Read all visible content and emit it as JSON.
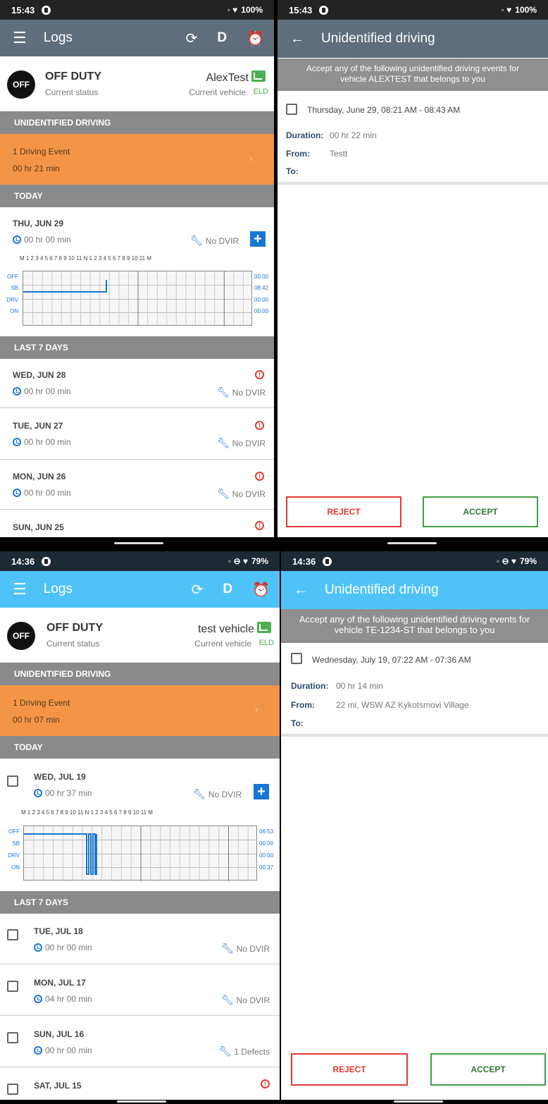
{
  "top_left": {
    "status_bar": {
      "time": "15:43",
      "battery": "100%"
    },
    "appbar": {
      "title": "Logs",
      "d_label": "D"
    },
    "status": {
      "badge": "OFF",
      "main": "OFF DUTY",
      "sub": "Current status",
      "vehicle": "AlexTest",
      "vehicle_sub": "Current vehicle",
      "eld": "ELD"
    },
    "unidentified_section": "UNIDENTIFIED DRIVING",
    "ud_event": {
      "title": "1 Driving Event",
      "duration": "00 hr  21 min"
    },
    "today_section": "TODAY",
    "today": {
      "date": "THU, JUN 29",
      "duration": "00 hr  00 min",
      "dvir": "No DVIR"
    },
    "grid": {
      "hours": "M 1 2 3 4 5 6 7 8 9 10 11 N 1 2 3 4 5 6 7 8 9 10 11 M",
      "rows": [
        "OFF",
        "SB",
        "DRV",
        "ON"
      ],
      "totals": [
        "00:00",
        "08:42",
        "00:00",
        "00:00"
      ]
    },
    "last7_section": "LAST 7 DAYS",
    "days": [
      {
        "date": "WED, JUN 28",
        "duration": "00 hr  00 min",
        "dvir": "No DVIR"
      },
      {
        "date": "TUE, JUN 27",
        "duration": "00 hr  00 min",
        "dvir": "No DVIR"
      },
      {
        "date": "MON, JUN 26",
        "duration": "00 hr  00 min",
        "dvir": "No DVIR"
      },
      {
        "date": "SUN, JUN 25"
      }
    ]
  },
  "top_right": {
    "status_bar": {
      "time": "15:43",
      "battery": "100%"
    },
    "header": {
      "title": "Unidentified driving"
    },
    "banner": {
      "line1": "Accept any of the following unidentified driving events for",
      "line2": "vehicle ALEXTEST that belongs to you"
    },
    "event": {
      "title": "Thursday, June 29, 08:21 AM - 08:43 AM",
      "duration_label": "Duration:",
      "duration": "00 hr  22 min",
      "from_label": "From:",
      "from": "Testt",
      "to_label": "To:"
    },
    "buttons": {
      "reject": "REJECT",
      "accept": "ACCEPT"
    }
  },
  "bottom_left": {
    "status_bar": {
      "time": "14:36",
      "battery": "79%"
    },
    "appbar": {
      "title": "Logs",
      "d_label": "D"
    },
    "status": {
      "badge": "OFF",
      "main": "OFF DUTY",
      "sub": "Current status",
      "vehicle": "test vehicle",
      "vehicle_sub": "Current vehicle",
      "eld": "ELD"
    },
    "unidentified_section": "UNIDENTIFIED DRIVING",
    "ud_event": {
      "title": "1 Driving Event",
      "duration": "00 hr  07 min"
    },
    "today_section": "TODAY",
    "today": {
      "date": "WED, JUL 19",
      "duration": "00 hr  37 min",
      "dvir": "No DVIR"
    },
    "grid": {
      "hours": "M 1 2 3 4 5 6 7 8 9 10 11 N 1 2 3 4 5 6 7 8 9 10 11 M",
      "rows": [
        "OFF",
        "SB",
        "DRV",
        "ON"
      ],
      "totals": [
        "06:53",
        "00:00",
        "00:00",
        "00:37"
      ]
    },
    "last7_section": "LAST 7 DAYS",
    "days": [
      {
        "date": "TUE, JUL 18",
        "duration": "00 hr  00 min",
        "dvir": "No DVIR"
      },
      {
        "date": "MON, JUL 17",
        "duration": "04 hr  00 min",
        "dvir": "No DVIR"
      },
      {
        "date": "SUN, JUL 16",
        "duration": "00 hr  00 min",
        "dvir": "1 Defects"
      },
      {
        "date": "SAT, JUL 15"
      }
    ]
  },
  "bottom_right": {
    "status_bar": {
      "time": "14:36",
      "battery": "79%"
    },
    "header": {
      "title": "Unidentified driving"
    },
    "banner": {
      "line1": "Accept any of the following unidentified driving events for",
      "line2": "vehicle TE-1234-ST that belongs to you"
    },
    "event": {
      "title": "Wednesday, July 19, 07:22 AM - 07:36 AM",
      "duration_label": "Duration:",
      "duration": "00 hr  14 min",
      "from_label": "From:",
      "from": "22 mi, WSW AZ Kykotsmovi Village",
      "to_label": "To:"
    },
    "buttons": {
      "reject": "REJECT",
      "accept": "ACCEPT"
    }
  },
  "colors": {
    "appbar_gray": "#5e6e7c",
    "appbar_blue": "#4fc3f7",
    "event_orange": "#f39447",
    "section_gray": "#8a8a8a",
    "accent_blue": "#1976d2",
    "reject_red": "#e53935",
    "accept_green": "#43a047"
  }
}
